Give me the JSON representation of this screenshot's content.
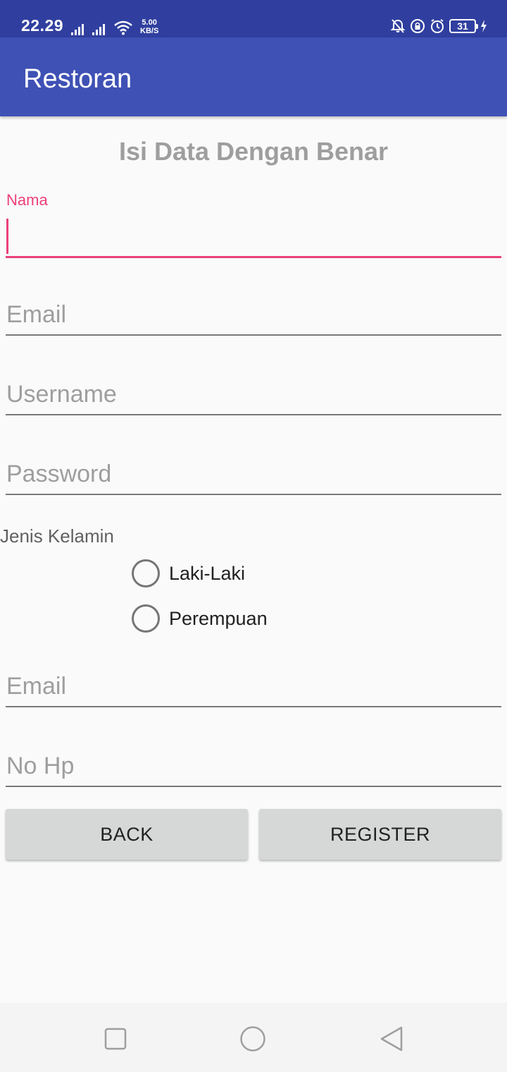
{
  "status_bar": {
    "time": "22.29",
    "net_speed_value": "5.00",
    "net_speed_unit": "KB/S",
    "battery_level": "31"
  },
  "app_bar": {
    "title": "Restoran"
  },
  "form": {
    "title": "Isi Data Dengan Benar",
    "nama_label": "Nama",
    "nama_value": "",
    "email_placeholder": "Email",
    "username_placeholder": "Username",
    "password_placeholder": "Password",
    "gender_label": "Jenis Kelamin",
    "gender_options": [
      "Laki-Laki",
      "Perempuan"
    ],
    "email2_placeholder": "Email",
    "phone_placeholder": "No Hp"
  },
  "buttons": {
    "back": "BACK",
    "register": "REGISTER"
  },
  "colors": {
    "status_bar": "#303f9f",
    "app_bar": "#3f51b5",
    "accent": "#ec407a",
    "button": "#d6d7d7"
  },
  "icons": {
    "status_left": [
      "signal-icon",
      "signal-icon",
      "wifi-icon"
    ],
    "status_right": [
      "mute-bell-icon",
      "rotation-lock-icon",
      "alarm-icon",
      "battery-icon",
      "charging-icon"
    ],
    "nav": [
      "recents-icon",
      "home-icon",
      "back-icon"
    ]
  }
}
